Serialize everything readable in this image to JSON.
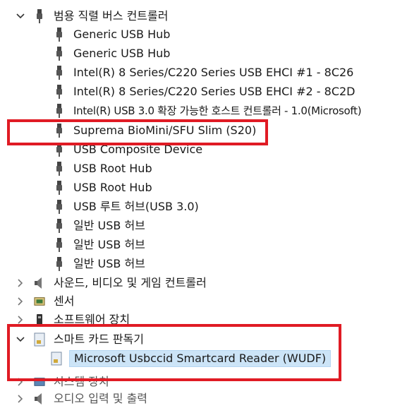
{
  "tree": {
    "usb_group": {
      "label": "범용 직렬 버스 컨트롤러",
      "icon": "usb-plug-icon",
      "expanded": true,
      "items": [
        {
          "label": "Generic USB Hub",
          "icon": "usb-plug-icon"
        },
        {
          "label": "Generic USB Hub",
          "icon": "usb-plug-icon"
        },
        {
          "label": "Intel(R) 8 Series/C220 Series USB EHCI #1 - 8C26",
          "icon": "usb-plug-icon"
        },
        {
          "label": "Intel(R) 8 Series/C220 Series USB EHCI #2 - 8C2D",
          "icon": "usb-plug-icon"
        },
        {
          "label": "Intel(R) USB 3.0 확장 가능한 호스트 컨트롤러 - 1.0(Microsoft)",
          "icon": "usb-plug-icon"
        },
        {
          "label": "Suprema BioMini/SFU Slim (S20)",
          "icon": "usb-plug-icon",
          "highlighted": true
        },
        {
          "label": "USB Composite Device",
          "icon": "usb-plug-icon"
        },
        {
          "label": "USB Root Hub",
          "icon": "usb-plug-icon"
        },
        {
          "label": "USB Root Hub",
          "icon": "usb-plug-icon"
        },
        {
          "label": "USB 루트 허브(USB 3.0)",
          "icon": "usb-plug-icon"
        },
        {
          "label": "일반 USB 허브",
          "icon": "usb-plug-icon"
        },
        {
          "label": "일반 USB 허브",
          "icon": "usb-plug-icon"
        },
        {
          "label": "일반 USB 허브",
          "icon": "usb-plug-icon"
        }
      ]
    },
    "sound_group": {
      "label": "사운드, 비디오 및 게임 컨트롤러",
      "icon": "speaker-icon",
      "expanded": false
    },
    "sensor_group": {
      "label": "센서",
      "icon": "sensor-icon",
      "expanded": false
    },
    "software_group": {
      "label": "소프트웨어 장치",
      "icon": "software-device-icon",
      "expanded": false
    },
    "smartcard_group": {
      "label": "스마트 카드 판독기",
      "icon": "smartcard-reader-icon",
      "expanded": true,
      "highlighted": true,
      "items": [
        {
          "label": "Microsoft Usbccid Smartcard Reader (WUDF)",
          "icon": "smartcard-reader-icon",
          "selected": true
        }
      ]
    },
    "system_group": {
      "label": "시스템 장치",
      "icon": "system-device-icon",
      "expanded": false
    },
    "audio_io_group": {
      "label": "오디오 입력 및 출력",
      "icon": "audio-io-icon",
      "expanded": false
    }
  },
  "colors": {
    "highlight_box": "#e01b24",
    "selection_bg": "#cce4f7",
    "text": "#1a1a1a"
  }
}
